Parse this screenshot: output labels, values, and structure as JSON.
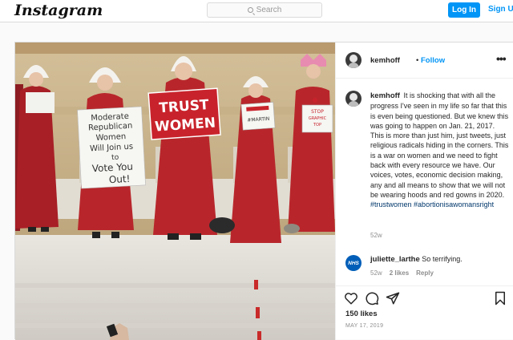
{
  "header": {
    "logo": "Instagram",
    "search_placeholder": "Search",
    "login_label": "Log In",
    "signup_label": "Sign Up"
  },
  "photo": {
    "sign_trust": "TRUST",
    "sign_women": "WOMEN",
    "sign_moderate": [
      "Moderate",
      "Republican",
      "Women",
      "Will Join us",
      "to",
      "Vote You",
      "Out!"
    ],
    "sign_martin": "#MARTIN",
    "sign_stop": [
      "STOP",
      "GRAPHIC",
      "TOP"
    ]
  },
  "post": {
    "username": "kemhoff",
    "dot": "•",
    "follow_label": "Follow",
    "more_icon": "more-horizontal-icon",
    "caption": "It is shocking that with all the progress I've seen in my life so far that this is even being questioned. But we knew this was going to happen on Jan. 21, 2017. This is more than just him, just tweets, just religious radicals hiding in the corners. This is a war on women and we need to fight back with every resource we have. Our voices, votes, economic decision making, any and all means to show that we will not be wearing hoods and red gowns in 2020.",
    "hashtag_1": "#trustwomen",
    "hashtag_2": "#abortionisawomansright",
    "caption_time": "52w",
    "comment": {
      "avatar_text": "NHS",
      "username": "juliette_larthe",
      "text": "So terrifying.",
      "time": "52w",
      "likes": "2 likes",
      "reply": "Reply"
    },
    "likes": "150 likes",
    "date": "MAY 17, 2019"
  },
  "colors": {
    "accent": "#0095f6",
    "robe": "#b8262b",
    "bonnet": "#f4f2ee"
  }
}
